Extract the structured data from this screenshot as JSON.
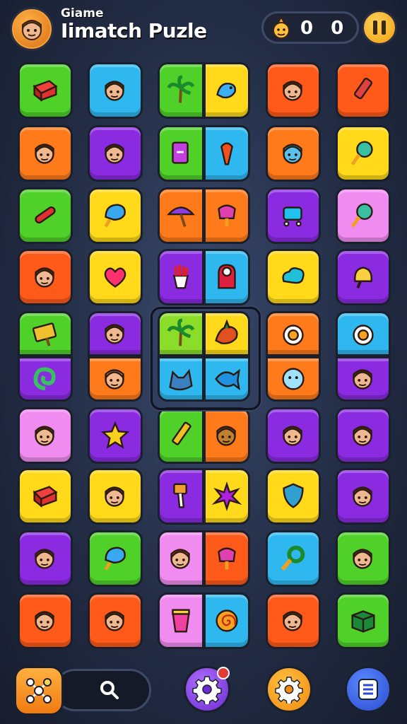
{
  "header": {
    "title_small": "Giame",
    "title_main": "Iimatch Puzle",
    "score": "0 0"
  },
  "colors": {
    "green": "#4fd12a",
    "cyan": "#2fb8ef",
    "orange": "#ff7a1a",
    "red_orange": "#ff5a1a",
    "purple": "#8a2be2",
    "pink": "#f08cf0",
    "yellow": "#ffd91a",
    "lime": "#8cdd2a"
  },
  "board": {
    "rows": [
      [
        "green:block-icon",
        "cyan:boy-icon",
        "green:palm-icon",
        "yellow:bird-icon",
        "red_orange:boy-icon",
        "red_orange:marker-icon"
      ],
      [
        "orange:boy-icon",
        "purple:boy-icon",
        "green:card-icon",
        "cyan:torch-icon",
        "orange:alien-icon",
        "yellow:lollipop-icon"
      ],
      [
        "green:candy-icon",
        "yellow:icecream-icon",
        "orange:umbrella-icon",
        "orange:popsicle-icon",
        "purple:cart-icon",
        "pink:lollipop-icon"
      ],
      [
        "red_orange:boy-icon",
        "yellow:heart-icon",
        "purple:fries-icon",
        "cyan:ghost-icon",
        "yellow:cloud-icon",
        "purple:bell-icon"
      ],
      [
        "green:sign-icon",
        "purple:boy-icon",
        "lime:palm-icon",
        "yellow:dragon-icon",
        "orange:egg-icon",
        "cyan:egg-icon"
      ],
      [
        "purple:swirl-icon",
        "orange:baby-icon",
        "cyan:wolf-icon",
        "cyan:fish-icon",
        "orange:bubble-icon",
        "purple:boy-icon"
      ],
      [
        "pink:boy-icon",
        "purple:star-icon",
        "green:pencil-icon",
        "orange:mask-icon",
        "purple:boy-icon",
        "purple:boy-icon"
      ],
      [
        "yellow:block-icon",
        "yellow:boy-icon",
        "purple:brush-icon",
        "yellow:splash-icon",
        "yellow:shield-icon",
        "purple:boy-icon"
      ],
      [
        "purple:boy-icon",
        "green:icecream-icon",
        "pink:girl-icon",
        "red_orange:popsicle-icon",
        "cyan:magnifier-icon",
        "green:boy-icon"
      ],
      [
        "red_orange:boy-icon",
        "red_orange:boy-icon",
        "pink:cup-icon",
        "cyan:spiral-icon",
        "red_orange:boy-icon",
        "green:box-icon"
      ]
    ]
  },
  "bottom": {
    "hint_icon": "network-icon",
    "search_icon": "search-icon",
    "settings_icon": "gear-icon",
    "settings_alt_icon": "gear-icon",
    "menu_icon": "list-icon"
  }
}
